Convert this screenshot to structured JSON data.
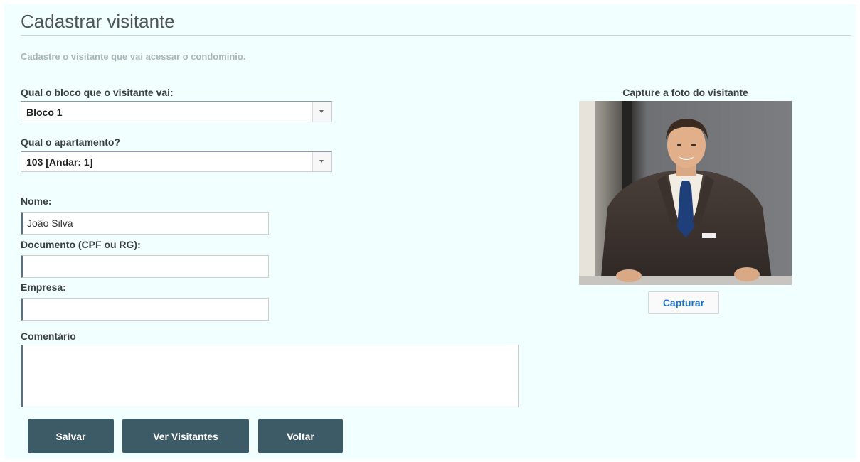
{
  "page": {
    "title": "Cadastrar visitante",
    "subtitle": "Cadastre o visitante que vai acessar o condominio."
  },
  "form": {
    "bloco": {
      "label": "Qual o bloco que o visitante vai:",
      "value": "Bloco 1"
    },
    "apartamento": {
      "label": "Qual o apartamento?",
      "value": "103 [Andar: 1]"
    },
    "nome": {
      "label": "Nome:",
      "value": "João Silva"
    },
    "documento": {
      "label": "Documento (CPF ou RG):",
      "value": ""
    },
    "empresa": {
      "label": "Empresa:",
      "value": ""
    },
    "comentario": {
      "label": "Comentário",
      "value": ""
    }
  },
  "actions": {
    "salvar": "Salvar",
    "ver_visitantes": "Ver Visitantes",
    "voltar": "Voltar"
  },
  "photo": {
    "label": "Capture a foto do visitante",
    "capture_button": "Capturar"
  },
  "colors": {
    "background": "#f2ffff",
    "button": "#3d5a67",
    "link_blue": "#1c73c4"
  }
}
